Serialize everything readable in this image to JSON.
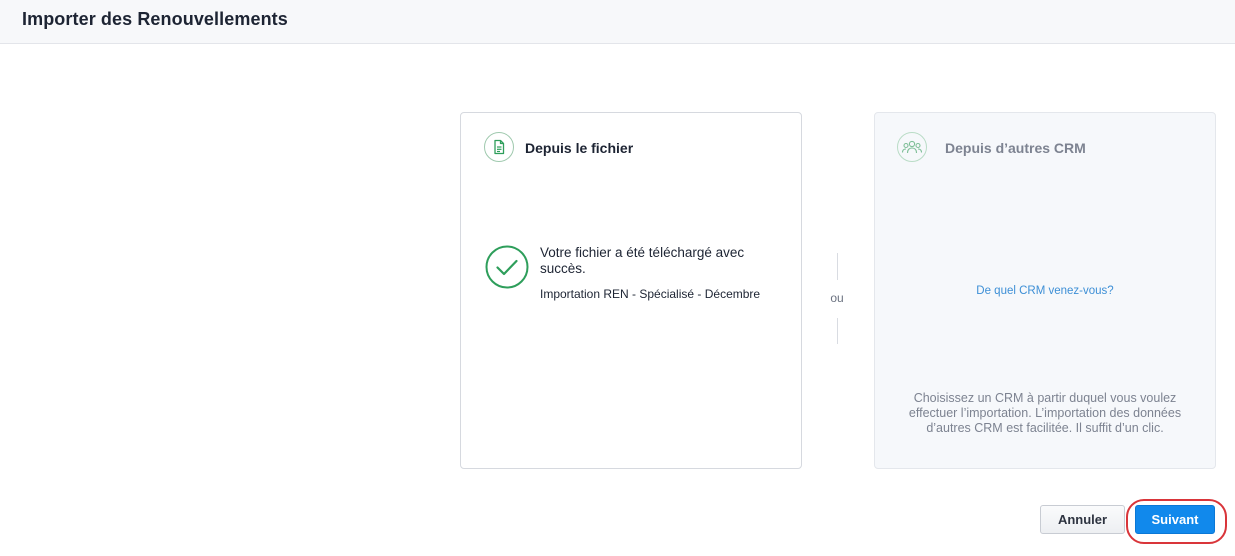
{
  "header": {
    "title": "Importer des Renouvellements"
  },
  "file_card": {
    "title": "Depuis le fichier",
    "icon": "document-icon",
    "success_message": "Votre fichier a été téléchargé avec succès.",
    "file_name": "Importation REN - Spécialisé - Décembre",
    "status_icon": "check-circle-icon",
    "accent_color": "#2e9e5b"
  },
  "divider": {
    "label": "ou"
  },
  "crm_card": {
    "title": "Depuis d’autres CRM",
    "icon": "users-group-icon",
    "link_text": "De quel CRM venez-vous?",
    "description": "Choisissez un CRM à partir duquel vous voulez effectuer l’importation. L’importation des données d’autres CRM est facilitée. Il suffit d’un clic."
  },
  "footer": {
    "cancel_label": "Annuler",
    "next_label": "Suivant",
    "primary_color": "#1189ec"
  }
}
